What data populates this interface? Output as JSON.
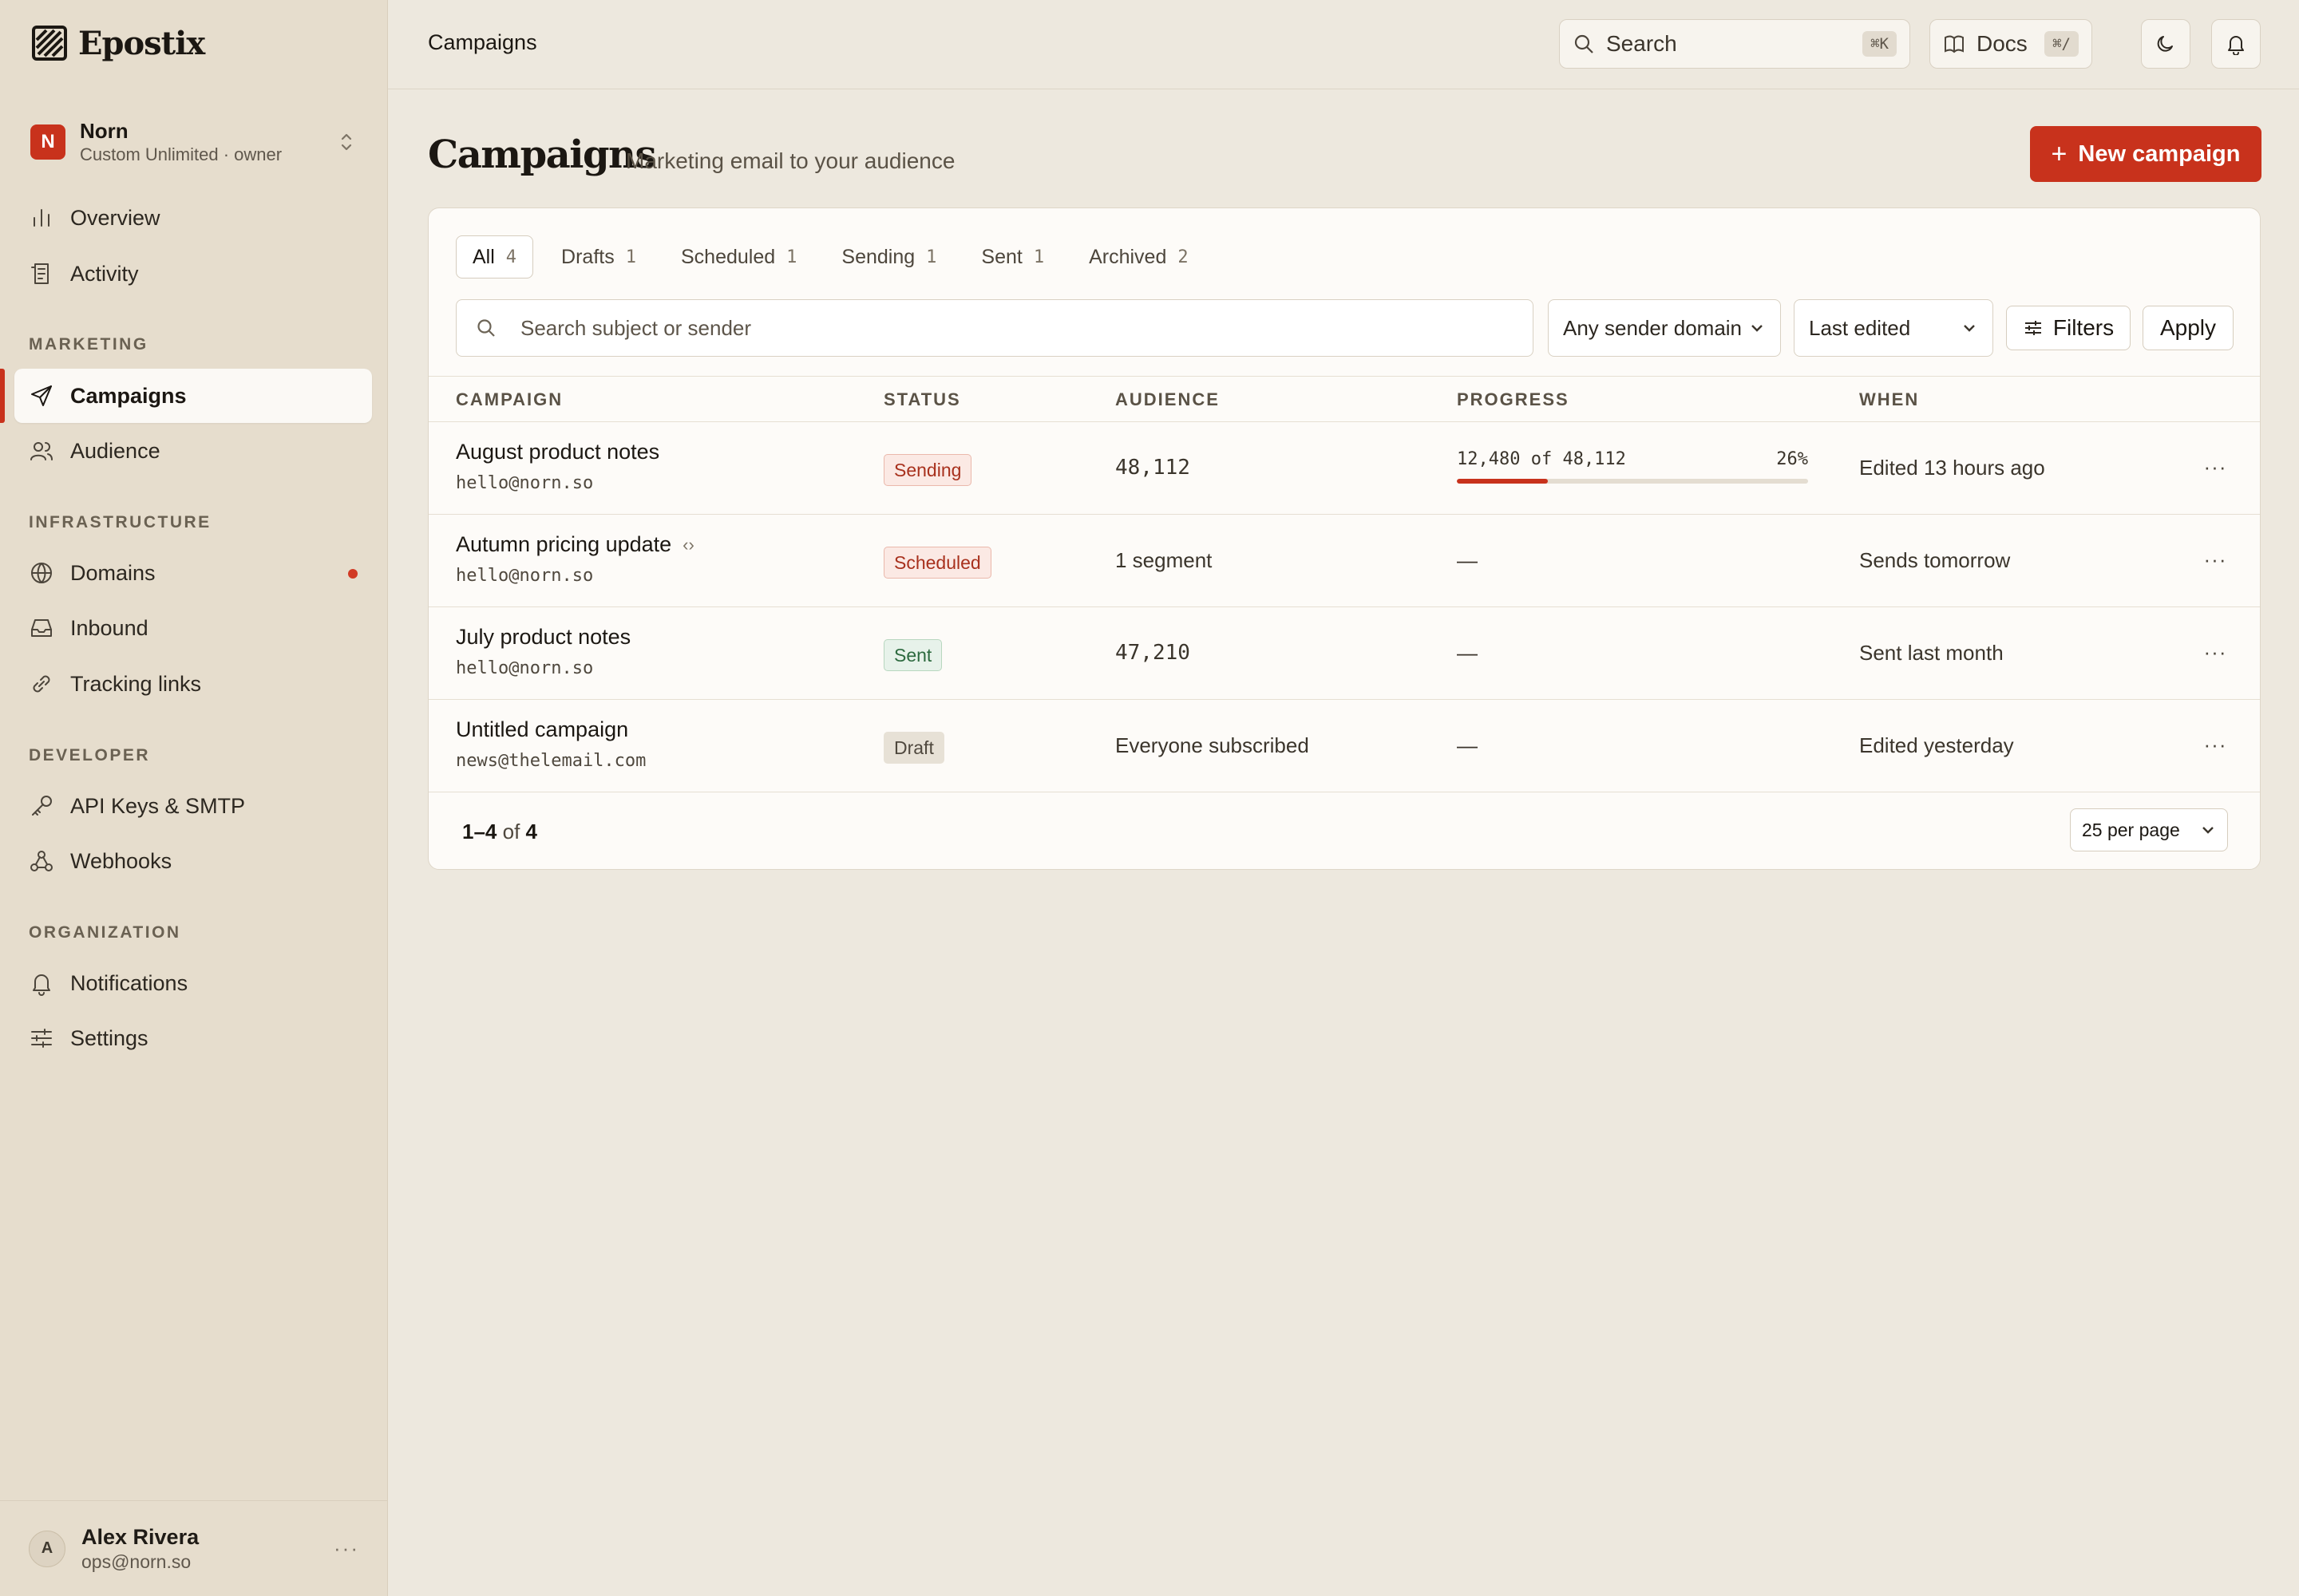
{
  "brand": {
    "name": "Epostix"
  },
  "workspace": {
    "initial": "N",
    "name": "Norn",
    "plan": "Custom Unlimited · owner"
  },
  "nav": {
    "overview": "Overview",
    "activity": "Activity",
    "section_marketing": "MARKETING",
    "campaigns": "Campaigns",
    "audience": "Audience",
    "section_infrastructure": "INFRASTRUCTURE",
    "domains": "Domains",
    "inbound": "Inbound",
    "tracking_links": "Tracking links",
    "section_developer": "DEVELOPER",
    "api_keys": "API Keys & SMTP",
    "webhooks": "Webhooks",
    "section_organization": "ORGANIZATION",
    "notifications": "Notifications",
    "settings": "Settings"
  },
  "user": {
    "initial": "A",
    "name": "Alex Rivera",
    "email": "ops@norn.so",
    "more": "···"
  },
  "topbar": {
    "title": "Campaigns",
    "search_label": "Search",
    "search_kbd": "⌘K",
    "docs_label": "Docs",
    "docs_kbd": "⌘/"
  },
  "page": {
    "title": "Campaigns",
    "subtitle": "Marketing email to your audience",
    "new_button": "New campaign",
    "new_button_icon": "+"
  },
  "tabs": [
    {
      "label": "All",
      "count": "4"
    },
    {
      "label": "Drafts",
      "count": "1"
    },
    {
      "label": "Scheduled",
      "count": "1"
    },
    {
      "label": "Sending",
      "count": "1"
    },
    {
      "label": "Sent",
      "count": "1"
    },
    {
      "label": "Archived",
      "count": "2"
    }
  ],
  "filters": {
    "search_placeholder": "Search subject or sender",
    "sender_domain": "Any sender domain",
    "sort": "Last edited",
    "filters_label": "Filters",
    "apply_label": "Apply"
  },
  "table": {
    "headers": {
      "campaign": "CAMPAIGN",
      "status": "STATUS",
      "audience": "AUDIENCE",
      "progress": "PROGRESS",
      "when": "WHEN"
    },
    "rows": [
      {
        "name": "August product notes",
        "sender": "hello@norn.so",
        "status": "Sending",
        "audience": "48,112",
        "progress": "12,480 of 48,112",
        "progress_pct": "26%",
        "progress_fraction": 0.26,
        "when": "Edited 13 hours ago"
      },
      {
        "name": "Autumn pricing update",
        "code_icon": "‹›",
        "sender": "hello@norn.so",
        "status": "Scheduled",
        "audience": "1 segment",
        "progress": "—",
        "when": "Sends tomorrow"
      },
      {
        "name": "July product notes",
        "sender": "hello@norn.so",
        "status": "Sent",
        "audience": "47,210",
        "progress": "—",
        "when": "Sent last month"
      },
      {
        "name": "Untitled campaign",
        "sender": "news@thelemail.com",
        "status": "Draft",
        "audience": "Everyone subscribed",
        "progress": "—",
        "when": "Edited yesterday"
      }
    ],
    "more_label": "···"
  },
  "footer": {
    "range": "1–4",
    "of_label": "of",
    "total": "4",
    "per_page": "25 per page"
  },
  "colors": {
    "accent": "#c8321c",
    "sidebar_bg": "#e6ddcd",
    "page_bg": "#ede8de"
  }
}
